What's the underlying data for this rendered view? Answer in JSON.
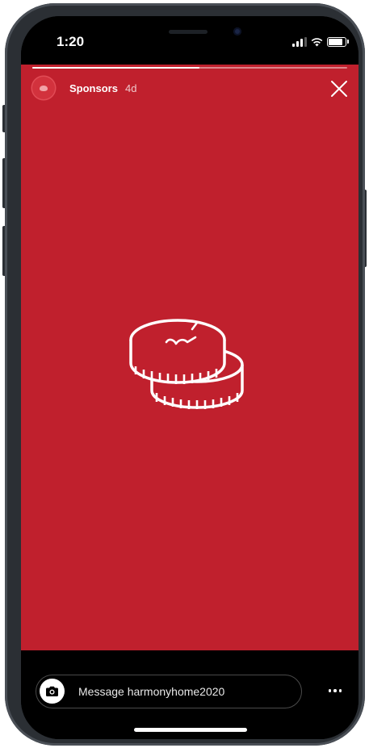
{
  "status_bar": {
    "time": "1:20",
    "icons": [
      "cellular-signal-icon",
      "wifi-icon",
      "battery-icon"
    ],
    "battery_level": 0.75
  },
  "story": {
    "background_color": "#c0202d",
    "progress": 0.53,
    "sponsor_name": "Sponsors",
    "post_age": "4d",
    "close_icon": "close-icon",
    "media_icon": "coins-stack-icon"
  },
  "reply": {
    "camera_icon": "camera-icon",
    "placeholder": "Message harmonyhome2020",
    "more_icon": "more-horizontal-icon"
  }
}
